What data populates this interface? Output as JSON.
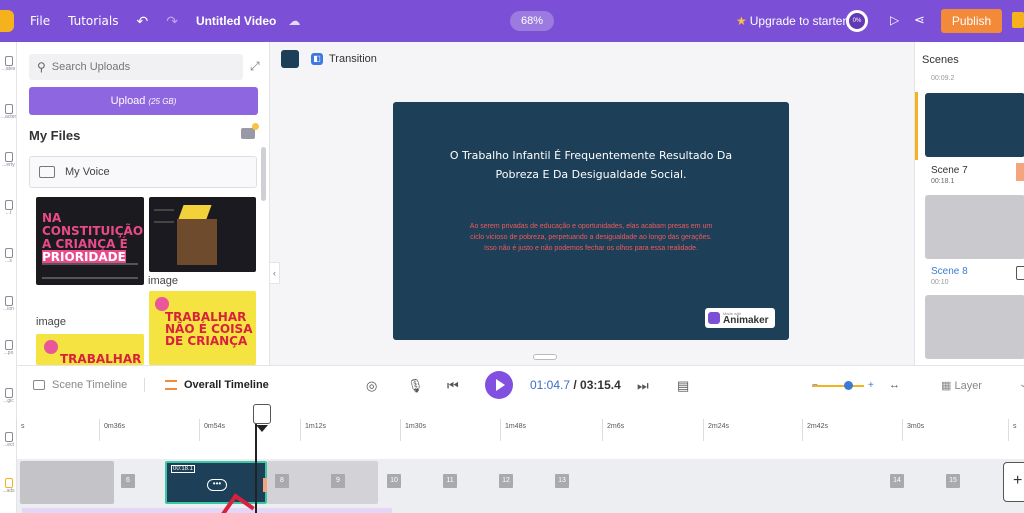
{
  "topbar": {
    "file": "File",
    "tutorials": "Tutorials",
    "undo_icon": "↶",
    "redo_icon": "↷",
    "title": "Untitled Video",
    "zoom": "68%",
    "upgrade": "Upgrade to starter",
    "progress_ring": "0%",
    "publish": "Publish",
    "brand_color": "#7b4fd6",
    "publish_color": "#f38a3a"
  },
  "rail": {
    "items": [
      "...ates",
      "...acter",
      "...erty",
      "...t",
      "...s",
      "...ion",
      "...po",
      "...gic",
      "...ect",
      "...ads"
    ]
  },
  "uploads": {
    "search_placeholder": "Search Uploads",
    "upload_label": "Upload",
    "upload_size": "(25 GB)",
    "my_files": "My Files",
    "my_voice": "My Voice",
    "thumb_labels": [
      "image",
      "image"
    ],
    "thumb1_text": [
      "NA CONSTITUIÇÃO",
      "A CRIANÇA É",
      "PRIORIDADE"
    ],
    "thumb3_text": [
      "TRABALHAR",
      "NÃO É COISA",
      "DE CRIANÇA"
    ],
    "thumb4_text": "TRABALHAR"
  },
  "stage": {
    "transition_label": "Transition",
    "bg_color": "#1d3f57",
    "slide_title_1": "O Trabalho Infantil É Frequentemente Resultado Da",
    "slide_title_2": "Pobreza E Da Desigualdade Social.",
    "slide_body_1": "Ao serem privadas de educação e oportunidades, elas acabam presas em um",
    "slide_body_2": "ciclo vicioso de pobreza, perpetuando a desigualdade ao longo das gerações.",
    "slide_body_3": "Isso não é justo e não podemos fechar os olhos para essa realidade.",
    "badge_small": "Made with",
    "badge_name": "Animaker"
  },
  "scenes": {
    "title": "Scenes",
    "top_duration": "00:09.2",
    "list": [
      {
        "name": "Scene 7",
        "duration": "00:18.1"
      },
      {
        "name": "Scene 8",
        "duration": "00:10"
      }
    ]
  },
  "timeline": {
    "scene_tab": "Scene Timeline",
    "overall_tab": "Overall Timeline",
    "current_time": "01:04.7",
    "total_time": "/ 03:15.4",
    "layer": "Layer",
    "ticks": [
      "s",
      "0m36s",
      "0m54s",
      "1m12s",
      "1m30s",
      "1m48s",
      "2m6s",
      "2m24s",
      "2m42s",
      "3m0s",
      "s"
    ],
    "clip_duration": "00:18.1",
    "scene_numbers": [
      "6",
      "8",
      "9",
      "10",
      "11",
      "12",
      "13",
      "14",
      "15"
    ],
    "add_scene": "+"
  }
}
